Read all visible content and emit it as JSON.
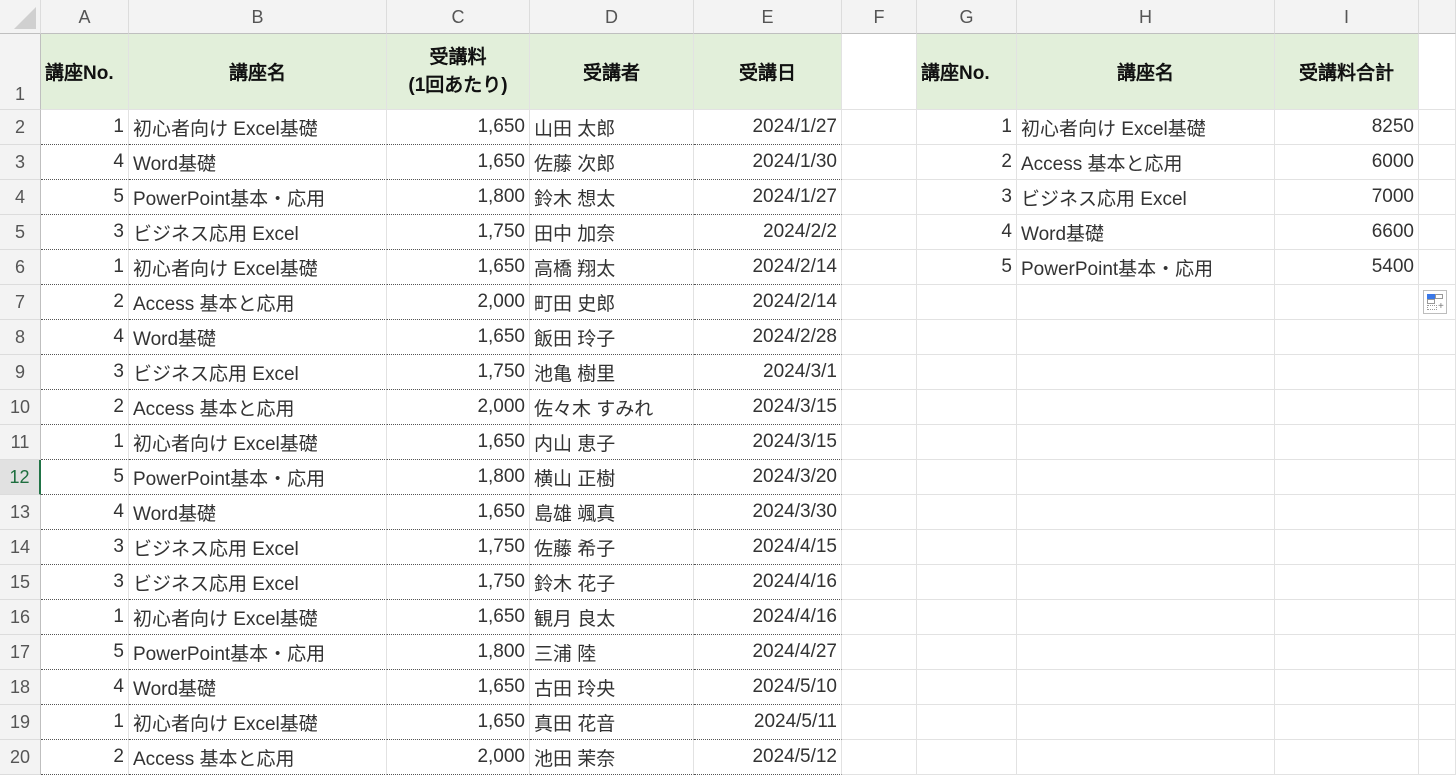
{
  "columns": [
    "A",
    "B",
    "C",
    "D",
    "E",
    "F",
    "G",
    "H",
    "I"
  ],
  "row_numbers": [
    "1",
    "2",
    "3",
    "4",
    "5",
    "6",
    "7",
    "8",
    "9",
    "10",
    "11",
    "12",
    "13",
    "14",
    "15",
    "16",
    "17",
    "18",
    "19",
    "20"
  ],
  "selected_row": "12",
  "main_table": {
    "headers": {
      "no": "講座No.",
      "name": "講座名",
      "fee_line1": "受講料",
      "fee_line2": "(1回あたり)",
      "student": "受講者",
      "date": "受講日"
    },
    "rows": [
      {
        "no": "1",
        "name": "初心者向け Excel基礎",
        "fee": "1,650",
        "student": "山田 太郎",
        "date": "2024/1/27"
      },
      {
        "no": "4",
        "name": "Word基礎",
        "fee": "1,650",
        "student": "佐藤 次郎",
        "date": "2024/1/30"
      },
      {
        "no": "5",
        "name": "PowerPoint基本・応用",
        "fee": "1,800",
        "student": "鈴木 想太",
        "date": "2024/1/27"
      },
      {
        "no": "3",
        "name": "ビジネス応用 Excel",
        "fee": "1,750",
        "student": "田中 加奈",
        "date": "2024/2/2"
      },
      {
        "no": "1",
        "name": "初心者向け Excel基礎",
        "fee": "1,650",
        "student": "高橋 翔太",
        "date": "2024/2/14"
      },
      {
        "no": "2",
        "name": "Access 基本と応用",
        "fee": "2,000",
        "student": "町田 史郎",
        "date": "2024/2/14"
      },
      {
        "no": "4",
        "name": "Word基礎",
        "fee": "1,650",
        "student": "飯田 玲子",
        "date": "2024/2/28"
      },
      {
        "no": "3",
        "name": "ビジネス応用 Excel",
        "fee": "1,750",
        "student": "池亀 樹里",
        "date": "2024/3/1"
      },
      {
        "no": "2",
        "name": "Access 基本と応用",
        "fee": "2,000",
        "student": "佐々木 すみれ",
        "date": "2024/3/15"
      },
      {
        "no": "1",
        "name": "初心者向け Excel基礎",
        "fee": "1,650",
        "student": "内山 恵子",
        "date": "2024/3/15"
      },
      {
        "no": "5",
        "name": "PowerPoint基本・応用",
        "fee": "1,800",
        "student": "横山 正樹",
        "date": "2024/3/20"
      },
      {
        "no": "4",
        "name": "Word基礎",
        "fee": "1,650",
        "student": "島雄 颯真",
        "date": "2024/3/30"
      },
      {
        "no": "3",
        "name": "ビジネス応用 Excel",
        "fee": "1,750",
        "student": "佐藤 希子",
        "date": "2024/4/15"
      },
      {
        "no": "3",
        "name": "ビジネス応用 Excel",
        "fee": "1,750",
        "student": "鈴木 花子",
        "date": "2024/4/16"
      },
      {
        "no": "1",
        "name": "初心者向け Excel基礎",
        "fee": "1,650",
        "student": "観月 良太",
        "date": "2024/4/16"
      },
      {
        "no": "5",
        "name": "PowerPoint基本・応用",
        "fee": "1,800",
        "student": "三浦 陸",
        "date": "2024/4/27"
      },
      {
        "no": "4",
        "name": "Word基礎",
        "fee": "1,650",
        "student": "古田 玲央",
        "date": "2024/5/10"
      },
      {
        "no": "1",
        "name": "初心者向け Excel基礎",
        "fee": "1,650",
        "student": "真田 花音",
        "date": "2024/5/11"
      },
      {
        "no": "2",
        "name": "Access 基本と応用",
        "fee": "2,000",
        "student": "池田 茉奈",
        "date": "2024/5/12"
      }
    ]
  },
  "summary_table": {
    "headers": {
      "no": "講座No.",
      "name": "講座名",
      "total": "受講料合計"
    },
    "rows": [
      {
        "no": "1",
        "name": "初心者向け Excel基礎",
        "total": "8250"
      },
      {
        "no": "2",
        "name": "Access 基本と応用",
        "total": "6000"
      },
      {
        "no": "3",
        "name": "ビジネス応用 Excel",
        "total": "7000"
      },
      {
        "no": "4",
        "name": "Word基礎",
        "total": "6600"
      },
      {
        "no": "5",
        "name": "PowerPoint基本・応用",
        "total": "5400"
      }
    ]
  },
  "paste_options_icon": "paste-options-icon",
  "colors": {
    "header_fill": "#e2efda",
    "grid": "#e2e2e2",
    "selected_row_accent": "#217346"
  }
}
